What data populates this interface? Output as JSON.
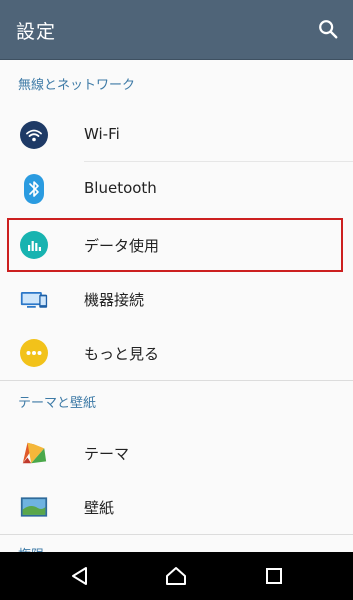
{
  "appbar": {
    "title": "設定",
    "search_icon": "search-icon"
  },
  "sections": [
    {
      "header": "無線とネットワーク"
    },
    {
      "header": "テーマと壁紙"
    },
    {
      "header": "権限"
    }
  ],
  "items": [
    {
      "label": "Wi-Fi",
      "icon": "wifi-icon",
      "icon_color": "#1e3a66"
    },
    {
      "label": "Bluetooth",
      "icon": "bluetooth-icon",
      "icon_color": "#2a9be0"
    },
    {
      "label": "データ使用",
      "icon": "data-usage-icon",
      "icon_color": "#18b3b0",
      "highlighted": true
    },
    {
      "label": "機器接続",
      "icon": "device-connection-icon",
      "icon_color": "#2b77c8"
    },
    {
      "label": "もっと見る",
      "icon": "more-icon",
      "icon_color": "#f2c21a"
    },
    {
      "label": "テーマ",
      "icon": "theme-icon",
      "icon_color": "#e05a2a"
    },
    {
      "label": "壁紙",
      "icon": "wallpaper-icon",
      "icon_color": "#2f6a9a"
    }
  ],
  "colors": {
    "appbar": "#4f6478",
    "section_header": "#3d7aa6",
    "highlight_border": "#cc1f1f"
  },
  "navbar": {
    "back": "back-icon",
    "home": "home-icon",
    "recents": "recents-icon"
  }
}
